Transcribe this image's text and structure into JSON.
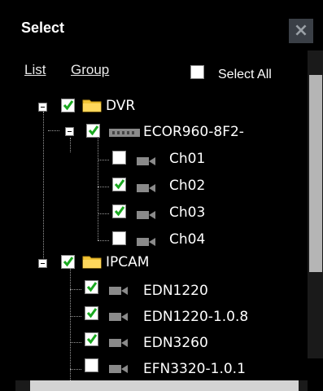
{
  "dialog": {
    "title": "Select",
    "close_icon": "×",
    "link_list": "List",
    "link_group": "Group",
    "select_all": "Select All"
  },
  "tree": {
    "dvr": {
      "label": "DVR",
      "checked": true
    },
    "device": {
      "label": "ECOR960-8F2-",
      "checked": true
    },
    "channels": [
      {
        "label": "Ch01",
        "checked": false
      },
      {
        "label": "Ch02",
        "checked": true
      },
      {
        "label": "Ch03",
        "checked": true
      },
      {
        "label": "Ch04",
        "checked": false
      }
    ],
    "ipcam": {
      "label": "IPCAM",
      "checked": true
    },
    "cameras": [
      {
        "label": "EDN1220",
        "checked": true
      },
      {
        "label": "EDN1220-1.0.8",
        "checked": true
      },
      {
        "label": "EDN3260",
        "checked": true
      },
      {
        "label": "EFN3320-1.0.1",
        "checked": false
      }
    ]
  },
  "colors": {
    "check_green": "#1aa820",
    "folder_yellow": "#f2c436",
    "cam_gray": "#8a8a8a"
  }
}
